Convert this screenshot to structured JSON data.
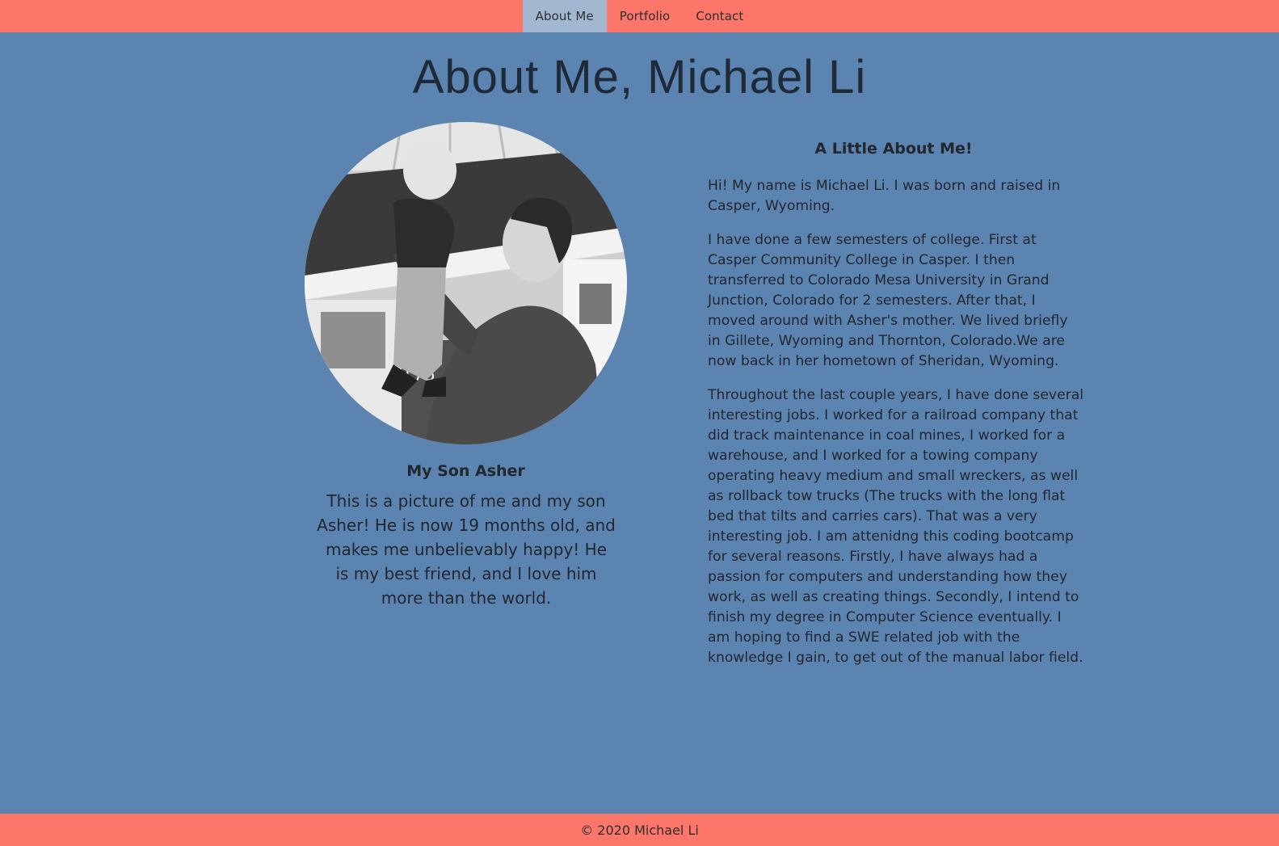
{
  "nav": {
    "items": [
      {
        "label": "About Me",
        "active": true
      },
      {
        "label": "Portfolio",
        "active": false
      },
      {
        "label": "Contact",
        "active": false
      }
    ]
  },
  "main": {
    "title": "About Me, Michael Li",
    "photo": {
      "heading": "My Son Asher",
      "caption": "This is a picture of me and my son Asher! He is now 19 months old, and makes me unbelievably happy! He is my best friend, and I love him more than the world."
    },
    "about": {
      "heading": "A Little About Me!",
      "paragraphs": [
        "Hi! My name is Michael Li. I was born and raised in Casper, Wyoming.",
        "I have done a few semesters of college. First at Casper Community College in Casper. I then transferred to Colorado Mesa University in Grand Junction, Colorado for 2 semesters. After that, I moved around with Asher's mother. We lived briefly in Gillete, Wyoming and Thornton, Colorado.We are now back in her hometown of Sheridan, Wyoming.",
        "Throughout the last couple years, I have done several interesting jobs. I worked for a railroad company that did track maintenance in coal mines, I worked for a warehouse, and I worked for a towing company operating heavy medium and small wreckers, as well as rollback tow trucks (The trucks with the long flat bed that tilts and carries cars). That was a very interesting job. I am attenidng this coding bootcamp for several reasons. Firstly, I have always had a passion for computers and understanding how they work, as well as creating things. Secondly, I intend to finish my degree in Computer Science eventually. I am hoping to find a SWE related job with the knowledge I gain, to get out of the manual labor field."
      ]
    }
  },
  "footer": {
    "text": "© 2020 Michael Li"
  },
  "colors": {
    "nav_bg": "#fc766a",
    "page_bg": "#5b84b1",
    "active_tab": "#a2b8d1"
  }
}
